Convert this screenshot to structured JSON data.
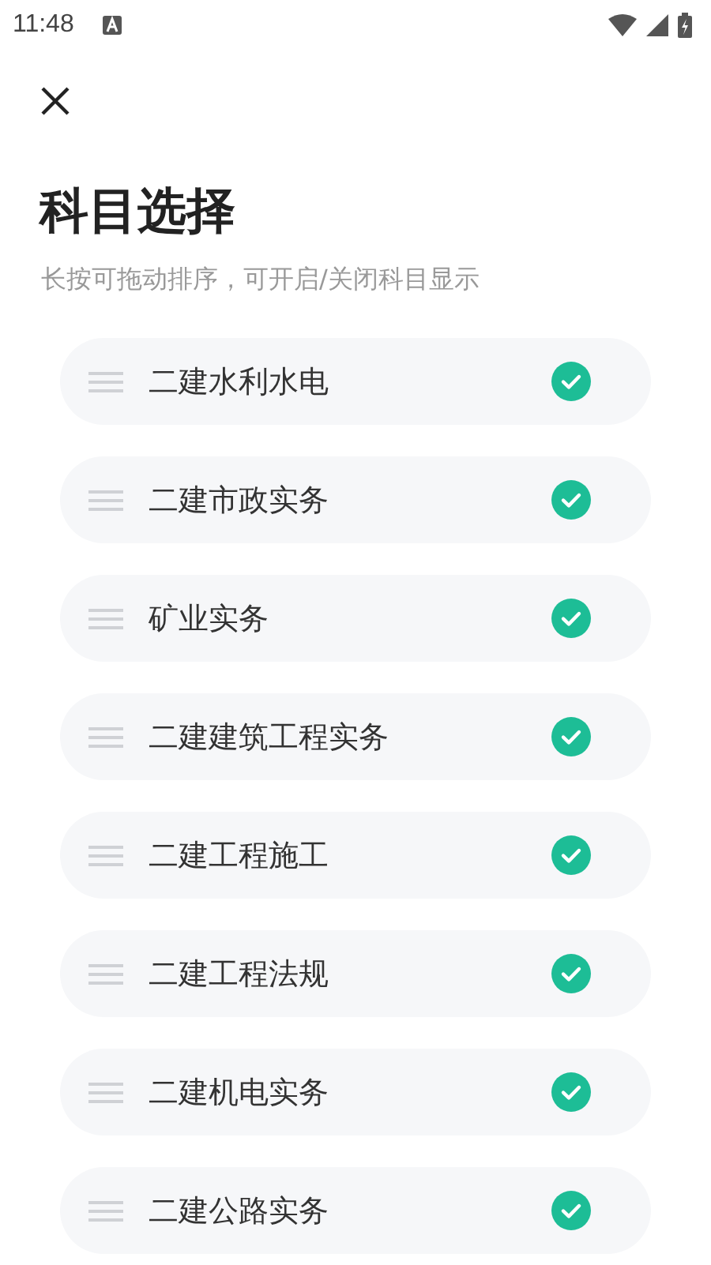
{
  "status_bar": {
    "time": "11:48"
  },
  "title": "科目选择",
  "subtitle": "长按可拖动排序，可开启/关闭科目显示",
  "subjects": [
    {
      "name": "二建水利水电",
      "checked": true
    },
    {
      "name": "二建市政实务",
      "checked": true
    },
    {
      "name": "矿业实务",
      "checked": true
    },
    {
      "name": "二建建筑工程实务",
      "checked": true
    },
    {
      "name": "二建工程施工",
      "checked": true
    },
    {
      "name": "二建工程法规",
      "checked": true
    },
    {
      "name": "二建机电实务",
      "checked": true
    },
    {
      "name": "二建公路实务",
      "checked": true
    }
  ]
}
